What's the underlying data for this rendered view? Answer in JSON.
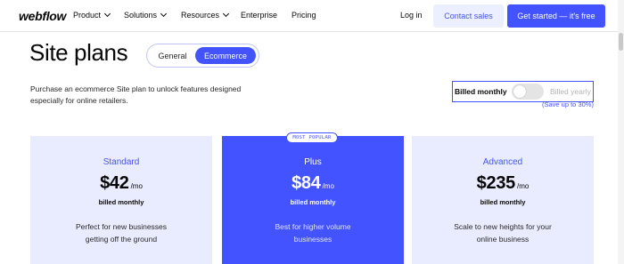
{
  "nav": {
    "logo": "webflow",
    "items": [
      {
        "label": "Product",
        "has_dropdown": true
      },
      {
        "label": "Solutions",
        "has_dropdown": true
      },
      {
        "label": "Resources",
        "has_dropdown": true
      },
      {
        "label": "Enterprise",
        "has_dropdown": false
      },
      {
        "label": "Pricing",
        "has_dropdown": false
      }
    ],
    "login": "Log in",
    "contact": "Contact sales",
    "cta": "Get started — it's free"
  },
  "header": {
    "title": "Site plans",
    "tabs": [
      {
        "label": "General",
        "active": false
      },
      {
        "label": "Ecommerce",
        "active": true
      }
    ],
    "description": "Purchase an ecommerce Site plan to unlock features designed especially for online retailers."
  },
  "billing": {
    "monthly_label": "Billed monthly",
    "yearly_label": "Billed yearly",
    "toggle_on": false,
    "save_note": "(Save up to 30%)"
  },
  "popular_badge": "MOST POPULAR",
  "plans": [
    {
      "name": "Standard",
      "price": "$42",
      "period": "/mo",
      "billed": "billed monthly",
      "blurb": "Perfect for new businesses getting off the ground",
      "featured": false
    },
    {
      "name": "Plus",
      "price": "$84",
      "period": "/mo",
      "billed": "billed monthly",
      "blurb": "Best for higher volume businesses",
      "featured": true
    },
    {
      "name": "Advanced",
      "price": "$235",
      "period": "/mo",
      "billed": "billed monthly",
      "blurb": "Scale to new heights for your online business",
      "featured": false
    }
  ],
  "colors": {
    "accent": "#4353ff",
    "accent_light": "#e9ecff",
    "text": "#080808"
  }
}
